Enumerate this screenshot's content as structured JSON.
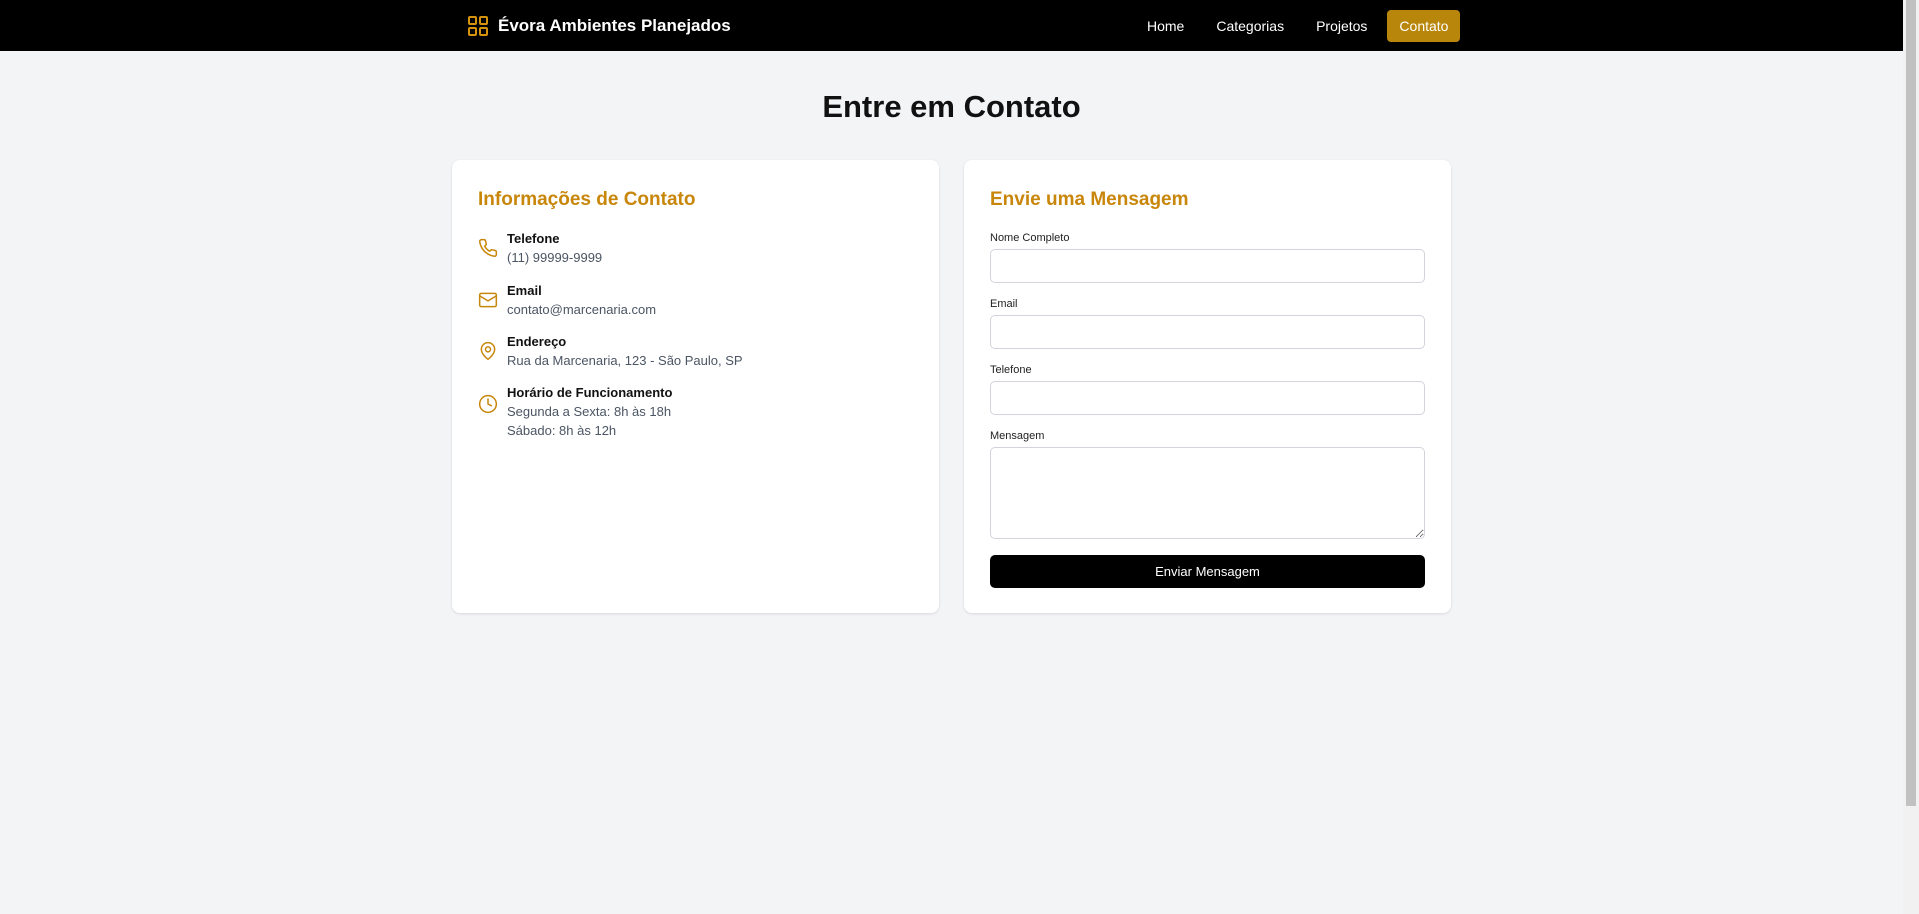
{
  "navbar": {
    "brand_name": "Évora Ambientes Planejados",
    "brand_icon": "grid-icon",
    "links": [
      {
        "label": "Home",
        "active": false
      },
      {
        "label": "Categorias",
        "active": false
      },
      {
        "label": "Projetos",
        "active": false
      },
      {
        "label": "Contato",
        "active": true
      }
    ]
  },
  "page": {
    "title": "Entre em Contato"
  },
  "contact_info": {
    "title": "Informações de Contato",
    "items": [
      {
        "icon": "phone-icon",
        "label": "Telefone",
        "values": [
          "(11) 99999-9999"
        ]
      },
      {
        "icon": "mail-icon",
        "label": "Email",
        "values": [
          "contato@marcenaria.com"
        ]
      },
      {
        "icon": "map-pin-icon",
        "label": "Endereço",
        "values": [
          "Rua da Marcenaria, 123 - São Paulo, SP"
        ]
      },
      {
        "icon": "clock-icon",
        "label": "Horário de Funcionamento",
        "values": [
          "Segunda a Sexta: 8h às 18h",
          "Sábado: 8h às 12h"
        ]
      }
    ]
  },
  "form": {
    "title": "Envie uma Mensagem",
    "fields": {
      "name": {
        "label": "Nome Completo",
        "value": ""
      },
      "email": {
        "label": "Email",
        "value": ""
      },
      "phone": {
        "label": "Telefone",
        "value": ""
      },
      "message": {
        "label": "Mensagem",
        "value": ""
      }
    },
    "submit_label": "Enviar Mensagem"
  },
  "colors": {
    "accent": "#c8860b",
    "active_nav": "#b8860b",
    "navbar_bg": "#000000",
    "page_bg": "#f3f4f6"
  }
}
